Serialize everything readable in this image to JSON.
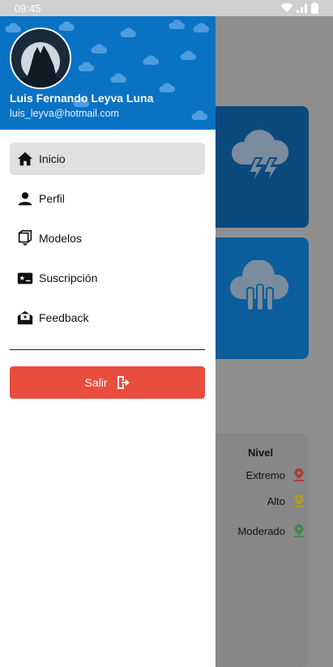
{
  "status_bar": {
    "time": "09:45"
  },
  "drawer": {
    "user": {
      "name": "Luis Fernando Leyva Luna",
      "email": "luis_leyva@hotmail.com"
    },
    "menu": [
      {
        "label": "Inicio",
        "icon": "home-icon",
        "active": true
      },
      {
        "label": "Perfil",
        "icon": "person-icon"
      },
      {
        "label": "Modelos",
        "icon": "cube-icon"
      },
      {
        "label": "Suscripción",
        "icon": "card-star-icon"
      },
      {
        "label": "Feedback",
        "icon": "envelope-icon"
      }
    ],
    "logout_label": "Salir"
  },
  "legend": {
    "title": "Nivel",
    "items": [
      {
        "label": "Extremo",
        "color": "#d23c3c"
      },
      {
        "label": "Alto",
        "color": "#d6b21c"
      },
      {
        "label": "Moderado",
        "color": "#3aa35a"
      }
    ]
  },
  "colors": {
    "header": "#0a72c3",
    "logout": "#e84d3d",
    "active_item": "#e0e0e0"
  }
}
